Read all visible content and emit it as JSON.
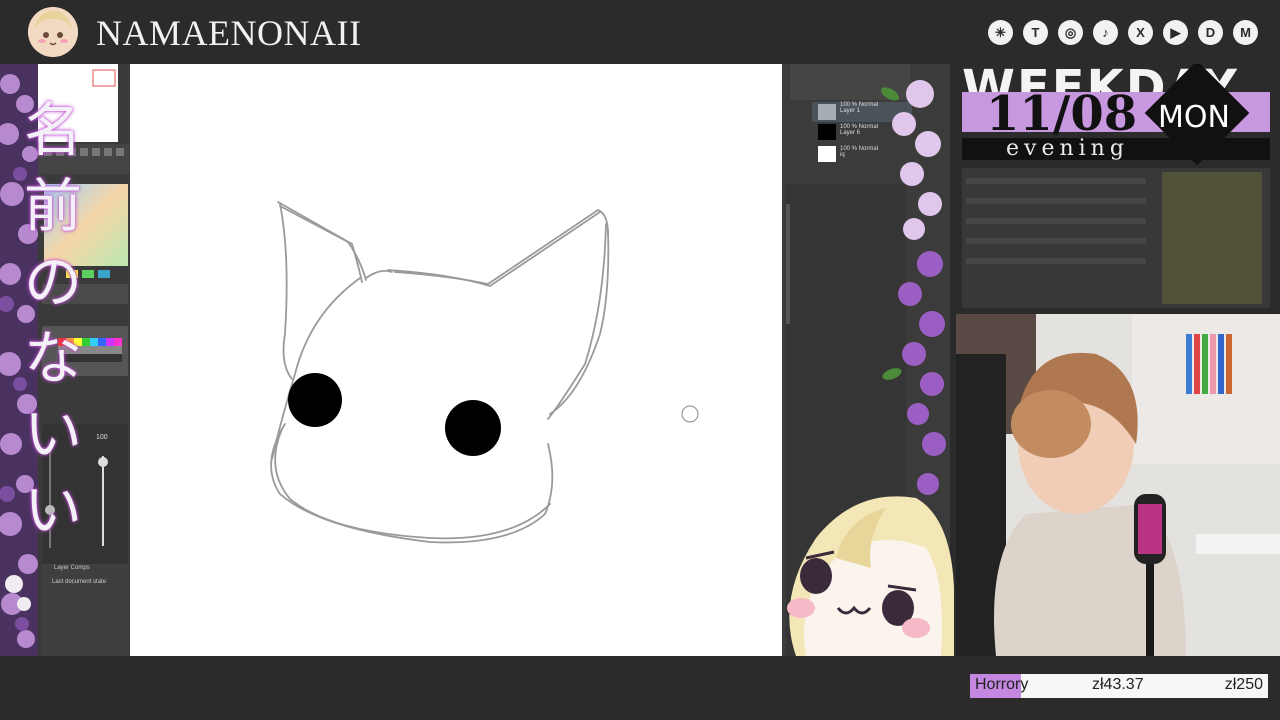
{
  "header": {
    "channel_name": "NAMAENONAII",
    "social_icons": [
      "linktree-icon",
      "twitch-icon",
      "instagram-icon",
      "tiktok-icon",
      "x-icon",
      "youtube-icon",
      "discord-icon",
      "gmail-icon"
    ],
    "social_glyphs": [
      "✳",
      "T",
      "◎",
      "♪",
      "X",
      "▶",
      "D",
      "M"
    ]
  },
  "side_text": {
    "kanji": [
      "名",
      "前",
      "の",
      "な",
      "い",
      "い"
    ]
  },
  "schedule": {
    "title": "WEEKDAY",
    "date": "11/08",
    "day": "MON",
    "period": "evening"
  },
  "app_left": {
    "brush_size": "100",
    "panel_label": "Layer Comps",
    "document_state": "Last document state"
  },
  "layers": [
    {
      "mode": "100 % Normal",
      "name": "Layer 1"
    },
    {
      "mode": "100 % Normal",
      "name": "Layer 6"
    },
    {
      "mode": "100 % Normal",
      "name": "iq"
    }
  ],
  "goal": {
    "label": "Horrory",
    "current": "zł43.37",
    "target": "zł250",
    "progress_fraction": 0.17
  },
  "colors": {
    "accent": "#c797e0",
    "background": "#2b2b2b"
  }
}
